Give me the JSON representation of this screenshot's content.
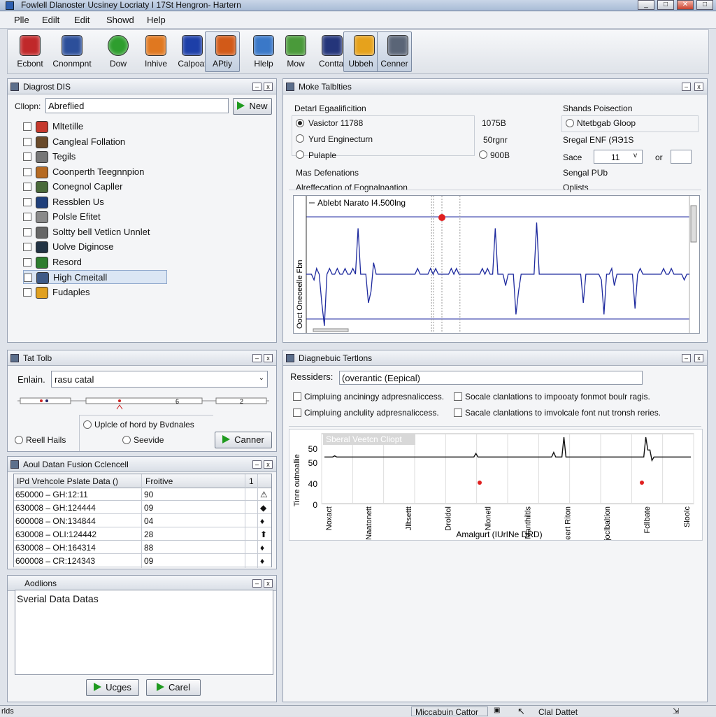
{
  "window": {
    "title": "Fowlell Dlanoster Ucsiney Locriaty I 17St Hengron- Hartern",
    "close": "✕"
  },
  "menu": [
    "Plle",
    "Edilt",
    "Edit",
    "Showd",
    "Help"
  ],
  "toolbar": [
    {
      "label": "Ecbont",
      "icon": "plane-icon",
      "color": "#c0282a"
    },
    {
      "label": "Cnonmpnt",
      "icon": "book-icon",
      "color": "#2c4f9a"
    },
    {
      "label": "Dow",
      "icon": "check-icon",
      "color": "#2e9e2e"
    },
    {
      "label": "Inhive",
      "icon": "bag-icon",
      "color": "#e07820"
    },
    {
      "label": "Calpoat",
      "icon": "cube-icon",
      "color": "#1d3fa8"
    },
    {
      "label": "APtiy",
      "icon": "play-icon",
      "color": "#d25a18"
    },
    {
      "label": "Hlelp",
      "icon": "car-icon",
      "color": "#3a78c8"
    },
    {
      "label": "Mow",
      "icon": "battery-icon",
      "color": "#4a9a3a"
    },
    {
      "label": "Conttal",
      "icon": "calculator-icon",
      "color": "#24357a"
    },
    {
      "label": "Ubbeh",
      "icon": "puzzle-icon",
      "color": "#e6a21c"
    },
    {
      "label": "Cenner",
      "icon": "device-icon",
      "color": "#5a6577"
    }
  ],
  "diag": {
    "title": "Diagrost DIS",
    "filter_label": "Cllopn:",
    "filter_value": "Abreflied",
    "new_label": "New",
    "items": [
      {
        "label": "Mltetille",
        "icon": "car-icon"
      },
      {
        "label": "Cangleal Follation",
        "icon": "engine-icon"
      },
      {
        "label": "Tegils",
        "icon": "document-icon"
      },
      {
        "label": "Coonperth Teegnnpion",
        "icon": "wrench-icon"
      },
      {
        "label": "Conegnol Capller",
        "icon": "battery-icon"
      },
      {
        "label": "Ressblen Us",
        "icon": "sensor-icon"
      },
      {
        "label": "Polsle Efitet",
        "icon": "doc-icon"
      },
      {
        "label": "Soltty bell Vetlicn Unnlet",
        "icon": "tool-icon"
      },
      {
        "label": "Uolve Diginose",
        "icon": "chip-icon"
      },
      {
        "label": "Resord",
        "icon": "leaf-icon"
      },
      {
        "label": "High Cmeitall",
        "icon": "folder-icon"
      },
      {
        "label": "Fudaples",
        "icon": "puzzle-icon"
      }
    ]
  },
  "tab": {
    "title": "Tat Tolb",
    "label": "Enlain.",
    "value": "rasu catal",
    "ticks": [
      "6",
      "2"
    ],
    "radio_top": "Uplcle of hord by Bvdnales",
    "radio_left": "Reell Hails",
    "radio_mid": "Seevide",
    "button": "Canner"
  },
  "fusion": {
    "title": "Aoul Datan Fusion Cclencell",
    "headers": [
      "IPd Vrehcole Pslate Data ()",
      "Froitive",
      "1"
    ],
    "rows": [
      {
        "id": "650000 – GH:12:11",
        "val": "90",
        "sym": "⚠"
      },
      {
        "id": "630008 – GH:124444",
        "val": "09",
        "sym": "◆"
      },
      {
        "id": "600008 – ON:134844",
        "val": "04",
        "sym": "♦"
      },
      {
        "id": "630008 – OLI:124442",
        "val": "28",
        "sym": "⬆"
      },
      {
        "id": "630008 – OH:164314",
        "val": "88",
        "sym": "♦"
      },
      {
        "id": "600008 – CR:124343",
        "val": "09",
        "sym": "♦"
      }
    ]
  },
  "actions": {
    "title": "Aodlions",
    "content": "Sverial Data Datas",
    "b1": "Ucges",
    "b2": "Carel"
  },
  "mode": {
    "title": "Moke Talblties",
    "sec1": "Detarl Egaalificition",
    "r1": "Vasictor 11788",
    "v1": "1075B",
    "r2": "Yurd Enginecturn",
    "v2": "50rgnr",
    "r3": "Pulaple",
    "v3": "900B",
    "sec2": "Shands Poisection",
    "r4": "Ntetbgab Gloop",
    "r5": "Sregal ENF (ЯЭ1S",
    "size_label": "Sace",
    "size_val": "11",
    "or": "or",
    "sensor": "Sengal PUb",
    "m_def": "Mas Defenations",
    "graph_title": "Alreffecation of Eognalnaation",
    "opt": "Oplists",
    "legend": "Ablebt Narato I4.500lng",
    "yaxis": "Ooct Oneoeelle Fbn"
  },
  "dtest": {
    "title": "Diagnebuic Tertlons",
    "label": "Ressiders:",
    "value": "(overantic (Eepical)",
    "c1": "Cimpluing anciningy adpresnaliccess.",
    "c2": "Socale clanlations to impooaty fonmot boulr ragis.",
    "c3": "Cimpluing anclulity adpresnaliccess.",
    "c4": "Sacale clanlations to imvolcale font nut tronsh reries.",
    "ylabel": "Tinre outnoallie"
  },
  "chart_data": [
    {
      "type": "line",
      "title": "",
      "legend": "Ablebt Narato I4.500lng",
      "series": [
        {
          "name": "Ablebt Narato I4.500lng",
          "values": [
            0,
            0,
            0,
            -0.1,
            0.1,
            0,
            -0.5,
            -0.9,
            0,
            0.1,
            0,
            0,
            0.1,
            0,
            0,
            0.1,
            0,
            0,
            0.1,
            0,
            0.8,
            0,
            0,
            0,
            -0.5,
            -0.3,
            0.2,
            0,
            0,
            0,
            0,
            0,
            0,
            0,
            0,
            0,
            0,
            0,
            0,
            0,
            0,
            0,
            0,
            0.1,
            0,
            0,
            0,
            0,
            0.1,
            0,
            0.1,
            0,
            0,
            0,
            0,
            0,
            0.1,
            0,
            0.1,
            0,
            0,
            0,
            0,
            0,
            0,
            0,
            0,
            0,
            0.1,
            0,
            0.1,
            0,
            0,
            0.8,
            0,
            0,
            0,
            -0.2,
            0,
            0,
            0,
            -0.7,
            -0.3,
            0,
            0,
            0,
            0,
            0,
            0,
            0.9,
            0,
            0,
            0,
            0,
            0,
            0,
            0,
            0,
            0,
            0,
            0,
            0,
            0,
            0,
            0,
            0,
            0,
            -0.5,
            0,
            0,
            0,
            0,
            0,
            0,
            -0.1,
            -0.7,
            0,
            0,
            0.1,
            -0.2,
            0,
            0,
            0,
            0,
            0,
            0,
            0,
            -0.6,
            0,
            0.1,
            0,
            0,
            0,
            0,
            0,
            0,
            0,
            0,
            0.1,
            0,
            0,
            0.1,
            0,
            0,
            0,
            0,
            -0.1,
            0,
            0
          ]
        }
      ]
    },
    {
      "type": "line",
      "title": "Sberal Veetcn Cliopt",
      "xlabel": "Amalgurt (IUrINe DRD)",
      "ylabel": "Tinre outnoallie",
      "yticks": [
        "50",
        "50",
        "40",
        "0"
      ],
      "categories": [
        "Noxact",
        "Naatonett",
        "Jlltsettt",
        "Droldol",
        "Nlonetl",
        "Manthiltls",
        "Moneert Riton",
        "Ejoclbaltion",
        "Fcllbate",
        "Sloolc"
      ],
      "series": [
        {
          "name": "",
          "values": [
            40,
            40,
            40,
            40,
            40,
            41,
            40,
            40,
            40,
            40,
            40,
            40,
            40,
            40,
            40,
            40,
            40,
            40,
            40,
            40,
            40,
            40,
            40,
            40,
            40,
            40,
            40,
            40,
            40,
            40,
            40,
            40,
            40,
            40,
            40,
            40,
            40,
            40,
            40,
            40,
            40,
            40,
            40,
            40,
            40,
            40,
            40,
            40,
            40,
            40,
            40,
            40,
            40,
            40,
            40,
            40,
            40,
            40,
            40,
            40,
            40,
            40,
            40,
            40,
            40,
            40,
            40,
            40,
            40,
            40,
            40,
            40,
            40,
            40,
            43,
            40,
            40,
            40,
            40,
            40,
            40,
            40,
            40,
            40,
            40,
            40,
            40,
            40,
            40,
            40,
            40,
            40,
            40,
            40,
            40,
            40,
            40,
            40,
            40,
            40,
            40,
            40,
            40,
            40,
            40,
            40,
            40,
            40,
            40,
            40,
            40,
            40,
            44,
            40,
            40,
            40,
            40,
            57,
            40,
            40,
            40,
            40,
            40,
            40,
            40,
            40,
            40,
            40,
            40,
            40,
            40,
            40,
            40,
            40,
            40,
            40,
            40,
            40,
            40,
            40,
            40,
            40,
            40,
            40,
            40,
            40,
            40,
            40,
            40,
            40,
            40,
            40,
            40,
            40,
            40,
            40,
            40,
            57,
            46,
            46,
            37,
            40,
            40,
            40,
            40,
            40,
            40,
            40,
            40,
            40,
            40,
            40,
            40,
            40,
            40,
            40,
            40,
            40,
            40,
            40
          ]
        }
      ]
    }
  ],
  "status": {
    "left": "rlds",
    "center": "Miccabuin Cattor",
    "right": "Clal Dattet"
  }
}
